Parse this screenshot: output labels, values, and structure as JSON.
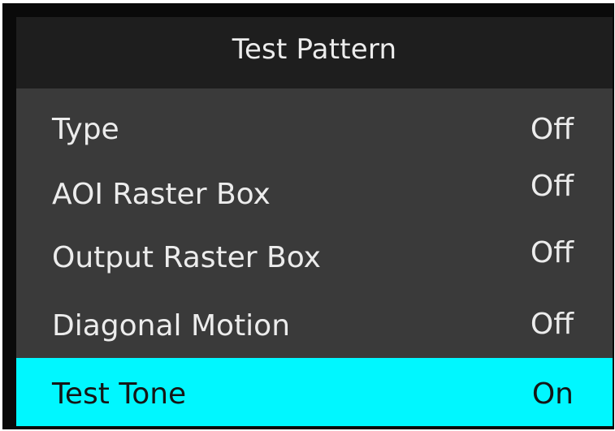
{
  "osd": {
    "title": "Test Pattern",
    "accent_color": "#00f7ff",
    "items": [
      {
        "label": "Type",
        "value": "Off",
        "selected": false
      },
      {
        "label": "AOI Raster Box",
        "value": "Off",
        "selected": false
      },
      {
        "label": "Output Raster Box",
        "value": "Off",
        "selected": false
      },
      {
        "label": "Diagonal Motion",
        "value": "Off",
        "selected": false
      },
      {
        "label": "Test Tone",
        "value": "On",
        "selected": true
      }
    ]
  }
}
